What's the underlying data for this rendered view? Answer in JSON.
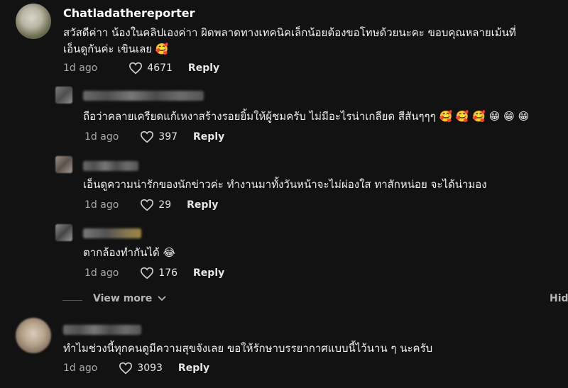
{
  "comments": [
    {
      "username": "Chatladathereporter",
      "text": "สวัสดีค่าา น้องในคลิปเองค่าา ผิดพลาดทางเทคนิคเล็กน้อยต้องขอโทษด้วยนะคะ ขอบคุณหลายเม้นที่",
      "text2": "เอ็นดูกันค่ะ เขินเลย 🥰",
      "date": "1d ago",
      "likes": "4671",
      "reply": "Reply"
    }
  ],
  "replies": [
    {
      "text": "ถือว่าคลายเครียดแก้เหงาสร้างรอยยิ้มให้ผู้ชมครับ ไม่มีอะไรน่าเกลียด สีสันๆๆๆ 🥰 🥰 🥰 😁 😁 😁",
      "date": "1d ago",
      "likes": "397",
      "reply": "Reply"
    },
    {
      "text": "เอ็นดูความน่ารักของนักข่าวค่ะ ทำงานมาทั้งวันหน้าจะไม่ผ่องใส ทาสักหน่อย จะได้น่ามอง",
      "date": "1d ago",
      "likes": "29",
      "reply": "Reply"
    },
    {
      "text": "ตากล้องทำกันได้ 😂",
      "date": "1d ago",
      "likes": "176",
      "reply": "Reply"
    }
  ],
  "view_more": "View more",
  "hide": "Hide",
  "last_comment": {
    "text": "ทำไมช่วงนี้ทุกคนดูมีความสุขจังเลย ขอให้รักษาบรรยากาศแบบนี้ไว้นาน ๆ นะครับ",
    "date": "1d ago",
    "likes": "3093",
    "reply": "Reply"
  }
}
